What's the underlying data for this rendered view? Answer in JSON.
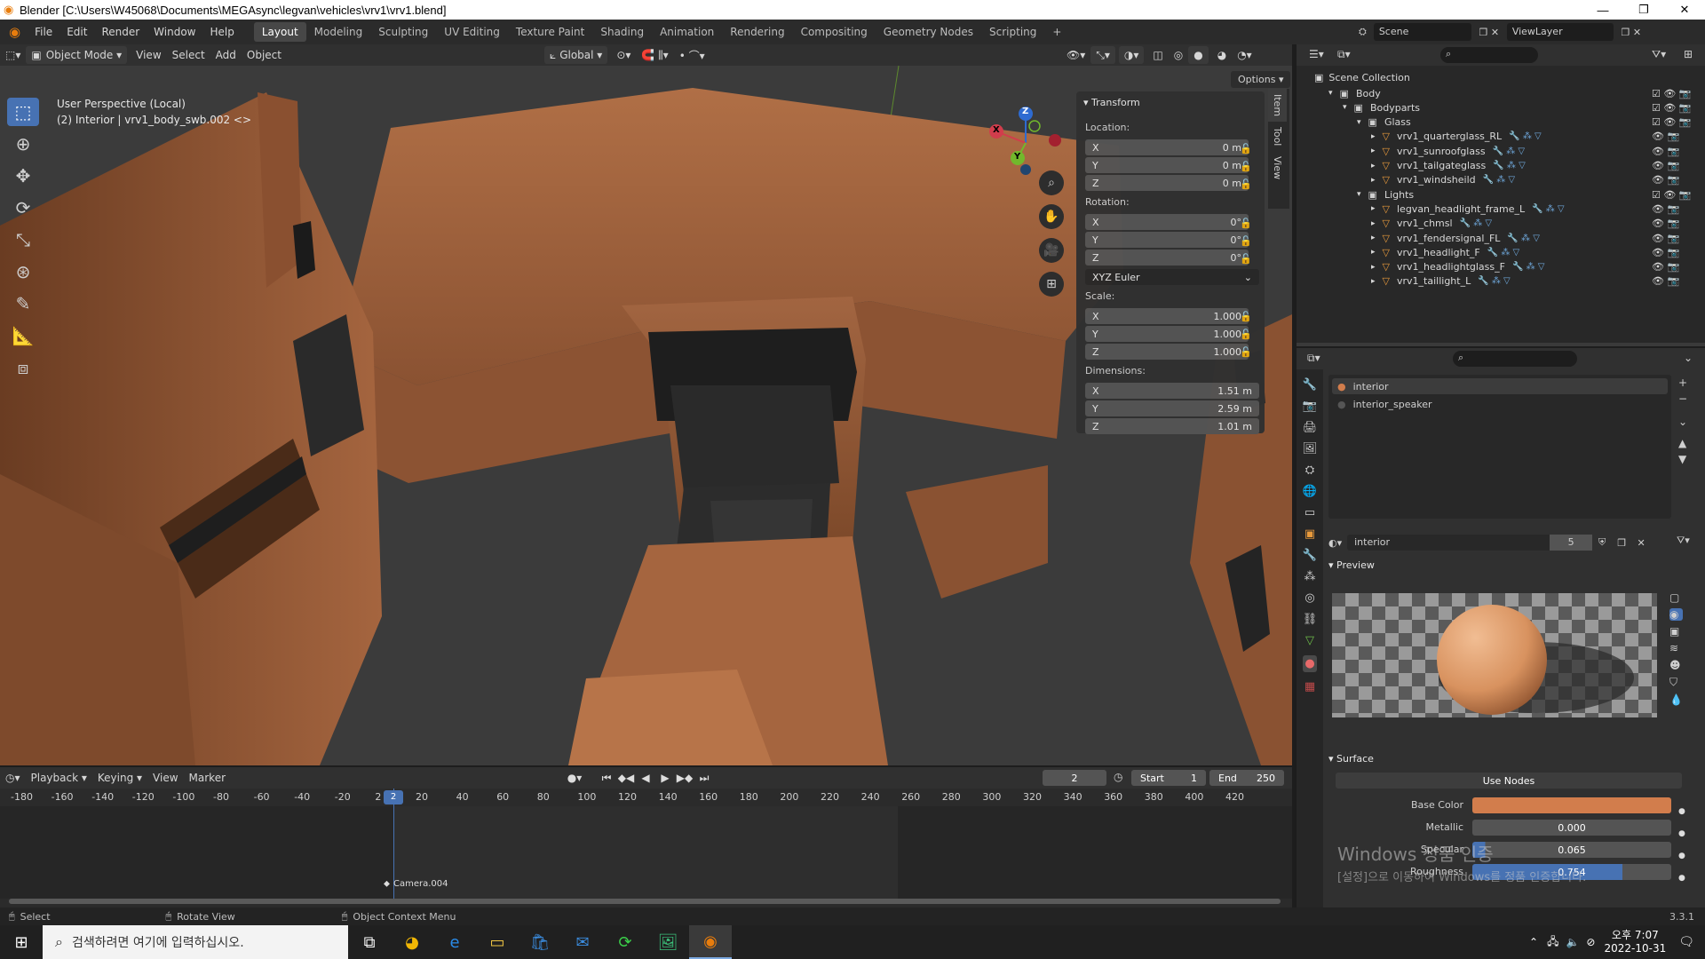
{
  "titlebar": {
    "title": "Blender [C:\\Users\\W45068\\Documents\\MEGAsync\\legvan\\vehicles\\vrv1\\vrv1.blend]",
    "min": "—",
    "max": "❐",
    "close": "✕"
  },
  "menus": [
    "File",
    "Edit",
    "Render",
    "Window",
    "Help"
  ],
  "workspaces": [
    "Layout",
    "Modeling",
    "Sculpting",
    "UV Editing",
    "Texture Paint",
    "Shading",
    "Animation",
    "Rendering",
    "Compositing",
    "Geometry Nodes",
    "Scripting"
  ],
  "active_workspace": "Layout",
  "scene": {
    "name": "Scene",
    "view_layer": "ViewLayer"
  },
  "vpheader": {
    "mode": "Object Mode",
    "view": "View",
    "select": "Select",
    "add": "Add",
    "object": "Object",
    "orientation": "Global",
    "options": "Options"
  },
  "viewport": {
    "perspective": "User Perspective (Local)",
    "object_info": "(2) Interior | vrv1_body_swb.002 <>"
  },
  "gizmo": {
    "x": "X",
    "y": "Y",
    "z": "Z"
  },
  "npanel": {
    "title": "Transform",
    "location_label": "Location:",
    "rotation_label": "Rotation:",
    "scale_label": "Scale:",
    "dimensions_label": "Dimensions:",
    "axes": [
      "X",
      "Y",
      "Z"
    ],
    "location": [
      "0 m",
      "0 m",
      "0 m"
    ],
    "rotation": [
      "0°",
      "0°",
      "0°"
    ],
    "rotation_mode": "XYZ Euler",
    "scale": [
      "1.000",
      "1.000",
      "1.000"
    ],
    "dimensions": [
      "1.51 m",
      "2.59 m",
      "1.01 m"
    ],
    "tabs": [
      "Item",
      "Tool",
      "View"
    ]
  },
  "outliner": {
    "root": "Scene Collection",
    "rows": [
      {
        "label": "Body",
        "indent": 1,
        "type": "collection"
      },
      {
        "label": "Bodyparts",
        "indent": 2,
        "type": "collection"
      },
      {
        "label": "Glass",
        "indent": 3,
        "type": "collection"
      },
      {
        "label": "vrv1_quarterglass_RL",
        "indent": 4,
        "type": "mesh"
      },
      {
        "label": "vrv1_sunroofglass",
        "indent": 4,
        "type": "mesh"
      },
      {
        "label": "vrv1_tailgateglass",
        "indent": 4,
        "type": "mesh"
      },
      {
        "label": "vrv1_windsheild",
        "indent": 4,
        "type": "mesh"
      },
      {
        "label": "Lights",
        "indent": 3,
        "type": "collection"
      },
      {
        "label": "legvan_headlight_frame_L",
        "indent": 4,
        "type": "mesh"
      },
      {
        "label": "vrv1_chmsl",
        "indent": 4,
        "type": "mesh"
      },
      {
        "label": "vrv1_fendersignal_FL",
        "indent": 4,
        "type": "mesh"
      },
      {
        "label": "vrv1_headlight_F",
        "indent": 4,
        "type": "mesh"
      },
      {
        "label": "vrv1_headlightglass_F",
        "indent": 4,
        "type": "mesh"
      },
      {
        "label": "vrv1_taillight_L",
        "indent": 4,
        "type": "mesh"
      }
    ]
  },
  "material": {
    "slots": [
      "interior",
      "interior_speaker"
    ],
    "name": "interior",
    "users": "5",
    "preview_label": "Preview",
    "surface_label": "Surface",
    "use_nodes": "Use Nodes",
    "base_color_label": "Base Color",
    "base_color": "#d27d4c",
    "metallic_label": "Metallic",
    "metallic": "0.000",
    "specular_label": "Specular",
    "specular": "0.065",
    "roughness_label": "Roughness",
    "roughness": "0.754"
  },
  "timeline": {
    "playback": "Playback",
    "keying": "Keying",
    "view": "View",
    "marker": "Marker",
    "current_frame": "2",
    "start_label": "Start",
    "start": "1",
    "end_label": "End",
    "end": "250",
    "ticks": [
      "-180",
      "-160",
      "-140",
      "-120",
      "-100",
      "-80",
      "-60",
      "-40",
      "-20",
      "2",
      "20",
      "40",
      "60",
      "80",
      "100",
      "120",
      "140",
      "160",
      "180",
      "200",
      "220",
      "240",
      "260",
      "280",
      "300",
      "320",
      "340",
      "360",
      "380",
      "400",
      "420"
    ],
    "marker_label": "Camera.004"
  },
  "status": {
    "select": "Select",
    "rotate": "Rotate View",
    "context": "Object Context Menu",
    "version": "3.3.1"
  },
  "watermark": {
    "line1": "Windows 정품 인증",
    "line2": "[설정]으로 이동하여 Windows를 정품 인증합니다."
  },
  "taskbar": {
    "search": "검색하려면 여기에 입력하십시오.",
    "time": "오후 7:07",
    "date": "2022-10-31"
  }
}
